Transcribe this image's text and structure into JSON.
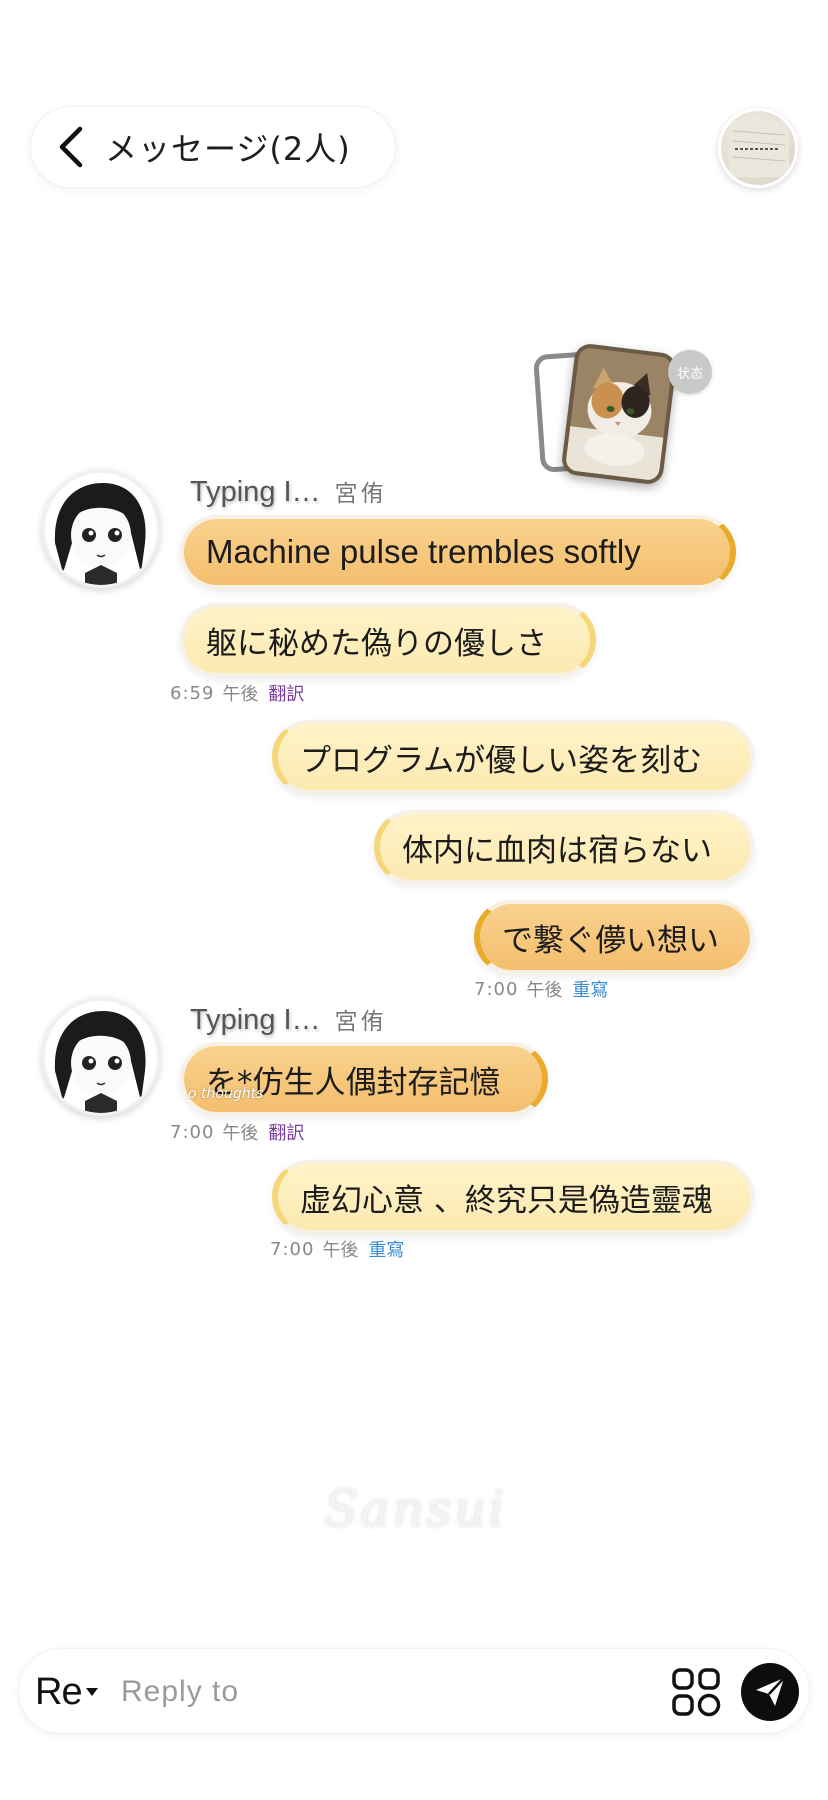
{
  "header": {
    "title": "メッセージ",
    "count": "(2人)",
    "back_icon": "chevron-left-icon",
    "avatar_icon": "notebook-photo-icon"
  },
  "status": {
    "badge": "状态",
    "card_icon": "cat-photo-icon"
  },
  "conversation": {
    "groups": [
      {
        "side": "left",
        "typing": "Typing I…",
        "sender": "宮侑",
        "messages": [
          "Machine pulse trembles softly",
          "躯に秘めた偽りの優しさ"
        ],
        "time": "6:59",
        "ampm": "午後",
        "action": "翻訳"
      },
      {
        "side": "right",
        "messages": [
          "プログラムが優しい姿を刻む",
          "体内に血肉は宿らない",
          "で繋ぐ儚い想い"
        ],
        "time": "7:00",
        "ampm": "午後",
        "action": "重寫"
      },
      {
        "side": "left",
        "typing": "Typing I…",
        "sender": "宮侑",
        "messages": [
          "を*仿生人偶封存記憶"
        ],
        "time": "7:00",
        "ampm": "午後",
        "action": "翻訳"
      },
      {
        "side": "right",
        "messages": [
          "虚幻心意 、終究只是偽造靈魂"
        ],
        "time": "7:00",
        "ampm": "午後",
        "action": "重寫"
      }
    ]
  },
  "overlay_text": "o thoughts",
  "watermark": "Sansui",
  "composer": {
    "mode_label": "Re",
    "placeholder": "Reply to",
    "apps_icon": "apps-grid-icon",
    "send_icon": "send-icon"
  },
  "colors": {
    "bubble_orange": "#f4be6e",
    "bubble_cream": "#fff3c9",
    "accent_gold": "#e8ab2a",
    "translate_link": "#7a3c9c",
    "rewrite_link": "#3b8ed6"
  }
}
